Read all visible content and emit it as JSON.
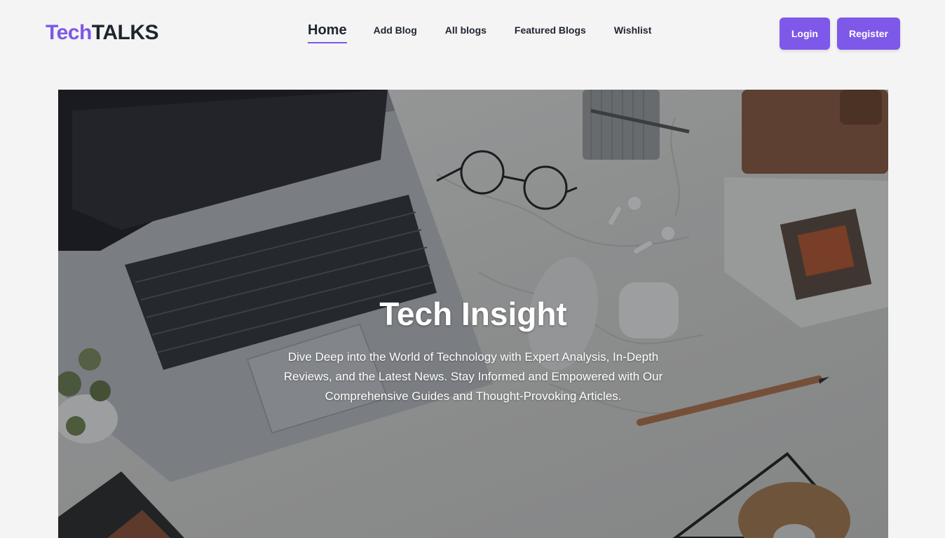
{
  "brand": {
    "part1": "Tech",
    "part2": "TALKS",
    "accent_color": "#7e58e8"
  },
  "nav": {
    "items": [
      {
        "label": "Home",
        "active": true
      },
      {
        "label": "Add Blog",
        "active": false
      },
      {
        "label": "All blogs",
        "active": false
      },
      {
        "label": "Featured Blogs",
        "active": false
      },
      {
        "label": "Wishlist",
        "active": false
      }
    ]
  },
  "auth": {
    "login_label": "Login",
    "register_label": "Register"
  },
  "hero": {
    "title": "Tech Insight",
    "description": "Dive Deep into the World of Technology with Expert Analysis, In-Depth Reviews, and the Latest News. Stay Informed and Empowered with Our Comprehensive Guides and Thought-Provoking Articles.",
    "image_icon": "desk-workspace-photo"
  }
}
